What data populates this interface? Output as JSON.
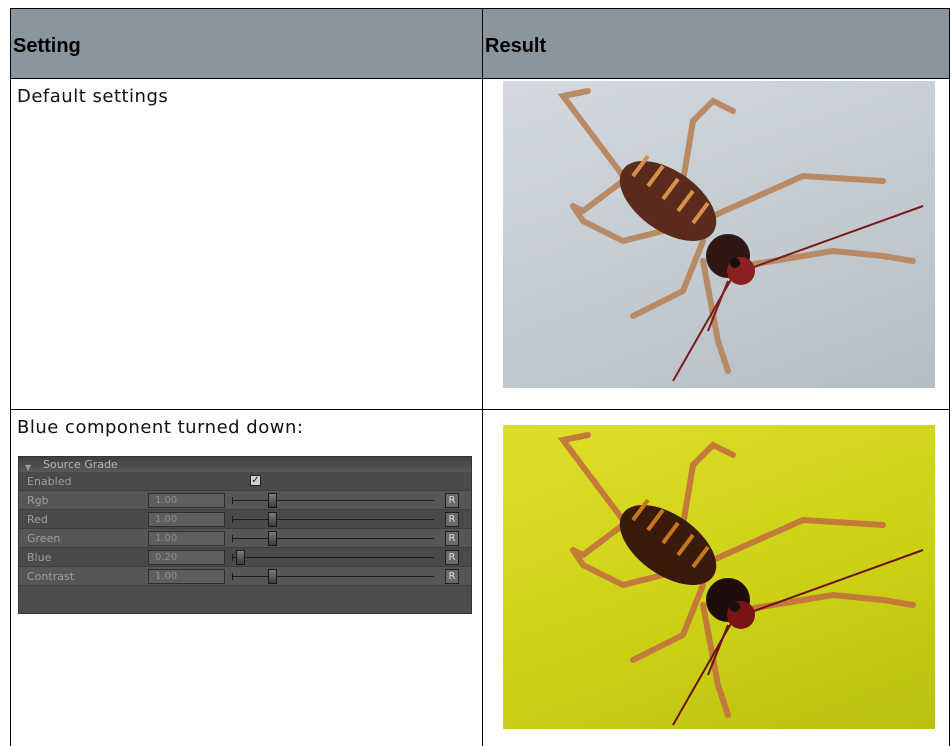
{
  "table": {
    "headers": {
      "setting": "Setting",
      "result": "Result"
    },
    "rows": [
      {
        "setting_text": "Default settings"
      },
      {
        "setting_text": "Blue component turned down:"
      }
    ]
  },
  "source_grade": {
    "title": "Source Grade",
    "enabled_label": "Enabled",
    "enabled": true,
    "check_glyph": "✓",
    "reset_label": "R",
    "params": [
      {
        "label": "Rgb",
        "value": "1.00",
        "fraction": 0.2
      },
      {
        "label": "Red",
        "value": "1.00",
        "fraction": 0.2
      },
      {
        "label": "Green",
        "value": "1.00",
        "fraction": 0.2
      },
      {
        "label": "Blue",
        "value": "0.20",
        "fraction": 0.04
      },
      {
        "label": "Contrast",
        "value": "1.00",
        "fraction": 0.2
      }
    ]
  },
  "images": [
    {
      "icon": "cricket-photo",
      "background": "#c8ced4"
    },
    {
      "icon": "cricket-photo-yellow",
      "background": "#d4d81c"
    }
  ]
}
